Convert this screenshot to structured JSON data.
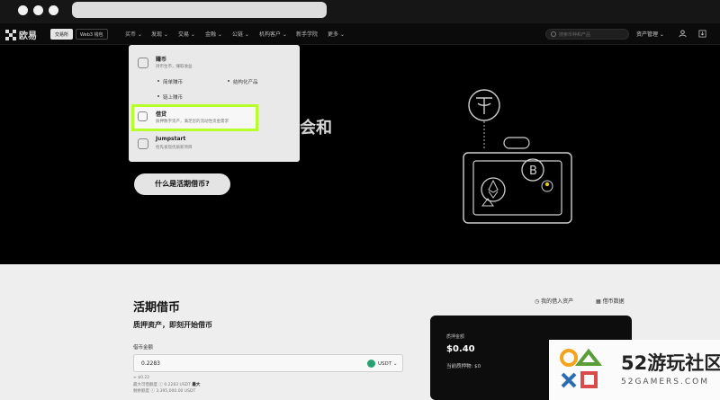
{
  "nav": {
    "brand": "欧易",
    "mode_tabs": [
      "交易所",
      "Web3 钱包"
    ],
    "items": [
      "买币",
      "发现",
      "交易",
      "金融",
      "公链",
      "机构客户",
      "新手学院",
      "更多"
    ],
    "search_placeholder": "搜索币种和产品",
    "assets": "资产管理"
  },
  "menu": {
    "items": [
      {
        "title": "赚币",
        "desc": "持币生币，赚取收益"
      },
      {
        "title": "借贷",
        "desc": "质押数字资产，满足您的流动性资金需求"
      },
      {
        "title": "Jumpstart",
        "desc": "抢先发现优质新项目"
      }
    ],
    "sub_items": [
      "简单赚币",
      "链上赚币",
      "结构化产品"
    ]
  },
  "hero": {
    "title_fragment": "会和",
    "cta": "什么是活期借币?"
  },
  "lower": {
    "title": "活期借币",
    "subtitle": "质押资产，即刻开始借币",
    "field_label": "借币金额",
    "amount": "0.2283",
    "currency": "USDT",
    "links": [
      "我的借入资产",
      "借币数据"
    ],
    "info_lines": [
      {
        "text": "≈ $0.22"
      },
      {
        "text": "最大可借额度 ⓘ 0.2283 USDT",
        "strong": "最大"
      },
      {
        "text": "剩余额度 ⓘ 3,395,000.00 USDT"
      }
    ],
    "card": {
      "label": "质押金额",
      "value": "$0.40",
      "collateral": "当前质押物: $0"
    }
  },
  "watermark": {
    "number": "52",
    "text": "游玩社区",
    "url": "52GAMERS.COM"
  }
}
